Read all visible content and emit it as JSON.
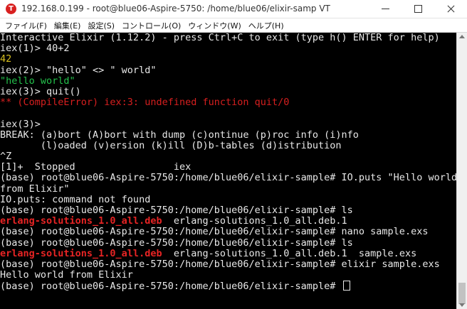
{
  "window": {
    "title": "192.168.0.199 - root@blue06-Aspire-5750: /home/blue06/elixir-samp VT",
    "app_icon": "teraterm-icon"
  },
  "menu": [
    {
      "label": "ファイル(F)"
    },
    {
      "label": "編集(E)"
    },
    {
      "label": "設定(S)"
    },
    {
      "label": "コントロール(O)"
    },
    {
      "label": "ウィンドウ(W)"
    },
    {
      "label": "ヘルプ(H)"
    }
  ],
  "terminal": {
    "lines": [
      {
        "text": "Interactive Elixir (1.12.2) - press Ctrl+C to exit (type h() ENTER for help)",
        "color": "default"
      },
      {
        "text": "iex(1)> 40+2",
        "color": "default"
      },
      {
        "text": "42",
        "color": "yellow"
      },
      {
        "text": "iex(2)> \"hello\" <> \" world\"",
        "color": "default"
      },
      {
        "text": "\"hello world\"",
        "color": "green"
      },
      {
        "text": "iex(3)> quit()",
        "color": "default"
      },
      {
        "text": "** (CompileError) iex:3: undefined function quit/0",
        "color": "red"
      },
      {
        "text": "",
        "color": "default"
      },
      {
        "text": "iex(3)>",
        "color": "default"
      },
      {
        "text": "BREAK: (a)bort (A)bort with dump (c)ontinue (p)roc info (i)nfo",
        "color": "default"
      },
      {
        "text": "       (l)oaded (v)ersion (k)ill (D)b-tables (d)istribution",
        "color": "default"
      },
      {
        "text": "^Z",
        "color": "default"
      },
      {
        "text": "[1]+  Stopped                 iex",
        "color": "default"
      },
      {
        "text": "(base) root@blue06-Aspire-5750:/home/blue06/elixir-sample# IO.puts \"Hello world",
        "color": "default"
      },
      {
        "text": "from Elixir\"",
        "color": "default"
      },
      {
        "text": "IO.puts: command not found",
        "color": "default"
      },
      {
        "text": "(base) root@blue06-Aspire-5750:/home/blue06/elixir-sample# ls",
        "color": "default"
      },
      {
        "segments": [
          {
            "text": "erlang-solutions_1.0_all.deb",
            "color": "red-bold"
          },
          {
            "text": "  erlang-solutions_1.0_all.deb.1",
            "color": "default"
          }
        ]
      },
      {
        "text": "(base) root@blue06-Aspire-5750:/home/blue06/elixir-sample# nano sample.exs",
        "color": "default"
      },
      {
        "text": "(base) root@blue06-Aspire-5750:/home/blue06/elixir-sample# ls",
        "color": "default"
      },
      {
        "segments": [
          {
            "text": "erlang-solutions_1.0_all.deb",
            "color": "red-bold"
          },
          {
            "text": "  erlang-solutions_1.0_all.deb.1  sample.exs",
            "color": "default"
          }
        ]
      },
      {
        "text": "(base) root@blue06-Aspire-5750:/home/blue06/elixir-sample# elixir sample.exs",
        "color": "default"
      },
      {
        "text": "Hello world from Elixir",
        "color": "default"
      },
      {
        "text": "(base) root@blue06-Aspire-5750:/home/blue06/elixir-sample# ",
        "color": "default",
        "cursor": true
      }
    ]
  },
  "colors": {
    "background": "#000000",
    "foreground": "#e8e8e8",
    "yellow": "#d8c020",
    "green": "#24c24c",
    "red": "#d81f1f"
  }
}
